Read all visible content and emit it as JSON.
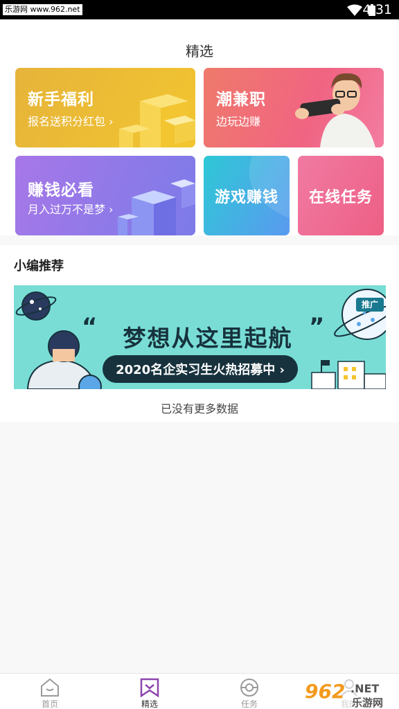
{
  "status_bar": {
    "watermark": "乐游网 www.962.net",
    "time": "4:31",
    "wifi_icon": "wifi-icon",
    "battery_icon": "battery-icon"
  },
  "page": {
    "title": "精选"
  },
  "cards": {
    "welfare": {
      "title": "新手福利",
      "subtitle": "报名送积分红包 ›"
    },
    "parttime": {
      "title": "潮兼职",
      "subtitle": "边玩边赚"
    },
    "earn": {
      "title": "赚钱必看",
      "subtitle": "月入过万不是梦 ›"
    },
    "game": {
      "title": "游戏赚钱"
    },
    "online": {
      "title": "在线任务"
    }
  },
  "recommend": {
    "section_title": "小编推荐",
    "banner": {
      "quote_left": "“",
      "headline": "梦想从这里起航",
      "quote_right": "”",
      "pill_text": "2020名企实习生火热招募中 ›",
      "tag": "推广"
    },
    "no_more": "已没有更多数据"
  },
  "tabbar": {
    "tabs": [
      {
        "label": "首页",
        "icon": "home-icon",
        "active": false
      },
      {
        "label": "精选",
        "icon": "featured-icon",
        "active": true
      },
      {
        "label": "任务",
        "icon": "task-icon",
        "active": false
      },
      {
        "label": "我的",
        "icon": "profile-icon",
        "active": false
      }
    ]
  },
  "watermark_bottom": {
    "number": "962",
    "suffix": ".NET",
    "brand": "乐游网"
  },
  "colors": {
    "accent": "#8e44ad",
    "card_welfare": "#f0be33",
    "card_parttime": "#f06a7d",
    "card_earn": "#9277ea",
    "card_game": "#3bb3e3",
    "card_online": "#ef6a90",
    "banner_bg": "#79ddd6"
  }
}
